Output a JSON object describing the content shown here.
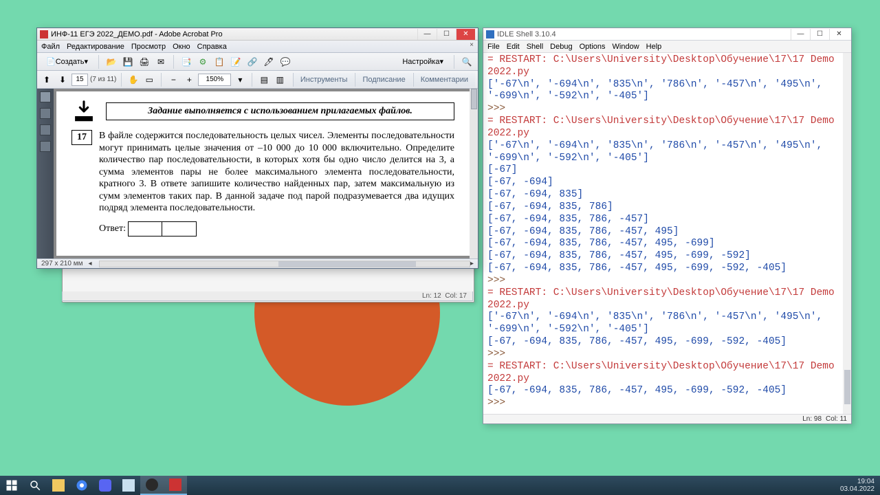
{
  "acrobat": {
    "title": "ИНФ-11 ЕГЭ 2022_ДЕМО.pdf - Adobe Acrobat Pro",
    "menu": [
      "Файл",
      "Редактирование",
      "Просмотр",
      "Окно",
      "Справка"
    ],
    "create_label": "Создать",
    "settings_label": "Настройка",
    "page_current": "15",
    "page_count": "(7 из 11)",
    "zoom": "150%",
    "right_links": {
      "tools": "Инструменты",
      "sign": "Подписание",
      "comments": "Комментарии"
    },
    "task_banner": "Задание выполняется с использованием прилагаемых файлов.",
    "task_number": "17",
    "task_text": "В файле содержится последовательность целых чисел. Элементы последовательности могут принимать целые значения от –10 000 до 10 000 включительно. Определите количество пар последовательности, в которых хотя бы одно число делится на 3, а сумма элементов пары не более максимального элемента последовательности, кратного 3. В ответе запишите количество найденных пар, затем максимальную из сумм элементов таких пар. В данной задаче под парой подразумевается два идущих подряд элемента последовательности.",
    "answer_label": "Ответ:",
    "page_dims": "297 x 210 мм"
  },
  "shadow": {
    "ln": "Ln: 12",
    "col": "Col: 17"
  },
  "idle": {
    "title": "IDLE Shell 3.10.4",
    "menu": [
      "File",
      "Edit",
      "Shell",
      "Debug",
      "Options",
      "Window",
      "Help"
    ],
    "restart": "= RESTART: C:\\Users\\University\\Desktop\\Обучение\\17\\17 Demo 2022.py",
    "list1": "['-67\\n', '-694\\n', '835\\n', '786\\n', '-457\\n', '495\\n', '-699\\n', '-592\\n', '-405']",
    "block2": [
      "[-67]",
      "[-67, -694]",
      "[-67, -694, 835]",
      "[-67, -694, 835, 786]",
      "[-67, -694, 835, 786, -457]",
      "[-67, -694, 835, 786, -457, 495]",
      "[-67, -694, 835, 786, -457, 495, -699]",
      "[-67, -694, 835, 786, -457, 495, -699, -592]",
      "[-67, -694, 835, 786, -457, 495, -699, -592, -405]"
    ],
    "final": "[-67, -694, 835, 786, -457, 495, -699, -592, -405]",
    "prompt": ">>> ",
    "ln": "Ln: 98",
    "col": "Col: 11"
  },
  "tray": {
    "time": "19:04",
    "date": "03.04.2022"
  }
}
